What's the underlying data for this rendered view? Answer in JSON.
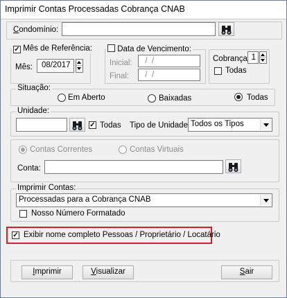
{
  "window": {
    "title": "Imprimir Contas Processadas Cobrança CNAB"
  },
  "condominio": {
    "label": "Condomínio:",
    "value": ""
  },
  "mes_referencia": {
    "label": "Mês de Referência:",
    "checked": true,
    "mes_label": "Mês:",
    "mes_value": "08/2017"
  },
  "data_vencimento": {
    "label": "Data de Vencimento:",
    "checked": false,
    "inicial_label": "Inicial:",
    "inicial_value": "  /  /",
    "final_label": "Final:",
    "final_value": "  /  /"
  },
  "cobranca": {
    "label": "Cobrança:",
    "value": "1",
    "todas_label": "Todas",
    "todas_checked": false
  },
  "situacao": {
    "label": "Situação:",
    "options": [
      "Em Aberto",
      "Baixadas",
      "Todas"
    ],
    "selected": "Todas"
  },
  "unidade": {
    "label": "Unidade:",
    "value": "",
    "todas_label": "Todas",
    "todas_checked": true,
    "tipo_label": "Tipo de Unidade:",
    "tipo_value": "Todos os Tipos"
  },
  "contas": {
    "options": [
      "Contas Correntes",
      "Contas Virtuais"
    ],
    "selected": "Contas Correntes",
    "conta_label": "Conta:",
    "conta_value": ""
  },
  "imprimir_contas": {
    "label": "Imprimir Contas:",
    "value": "Processadas para a Cobrança CNAB",
    "nosso_numero_label": "Nosso Número Formatado",
    "nosso_numero_checked": false
  },
  "exibir_nome": {
    "label": "Exibir nome completo Pessoas / Proprietário / Locatário",
    "checked": true,
    "highlight_color": "#d91f26"
  },
  "buttons": {
    "imprimir_first": "I",
    "imprimir_rest": "mprimir",
    "visualizar_first": "V",
    "visualizar_rest": "isualizar",
    "sair_first": "S",
    "sair_rest": "air"
  },
  "icons": {
    "search": "binoculars-icon"
  }
}
